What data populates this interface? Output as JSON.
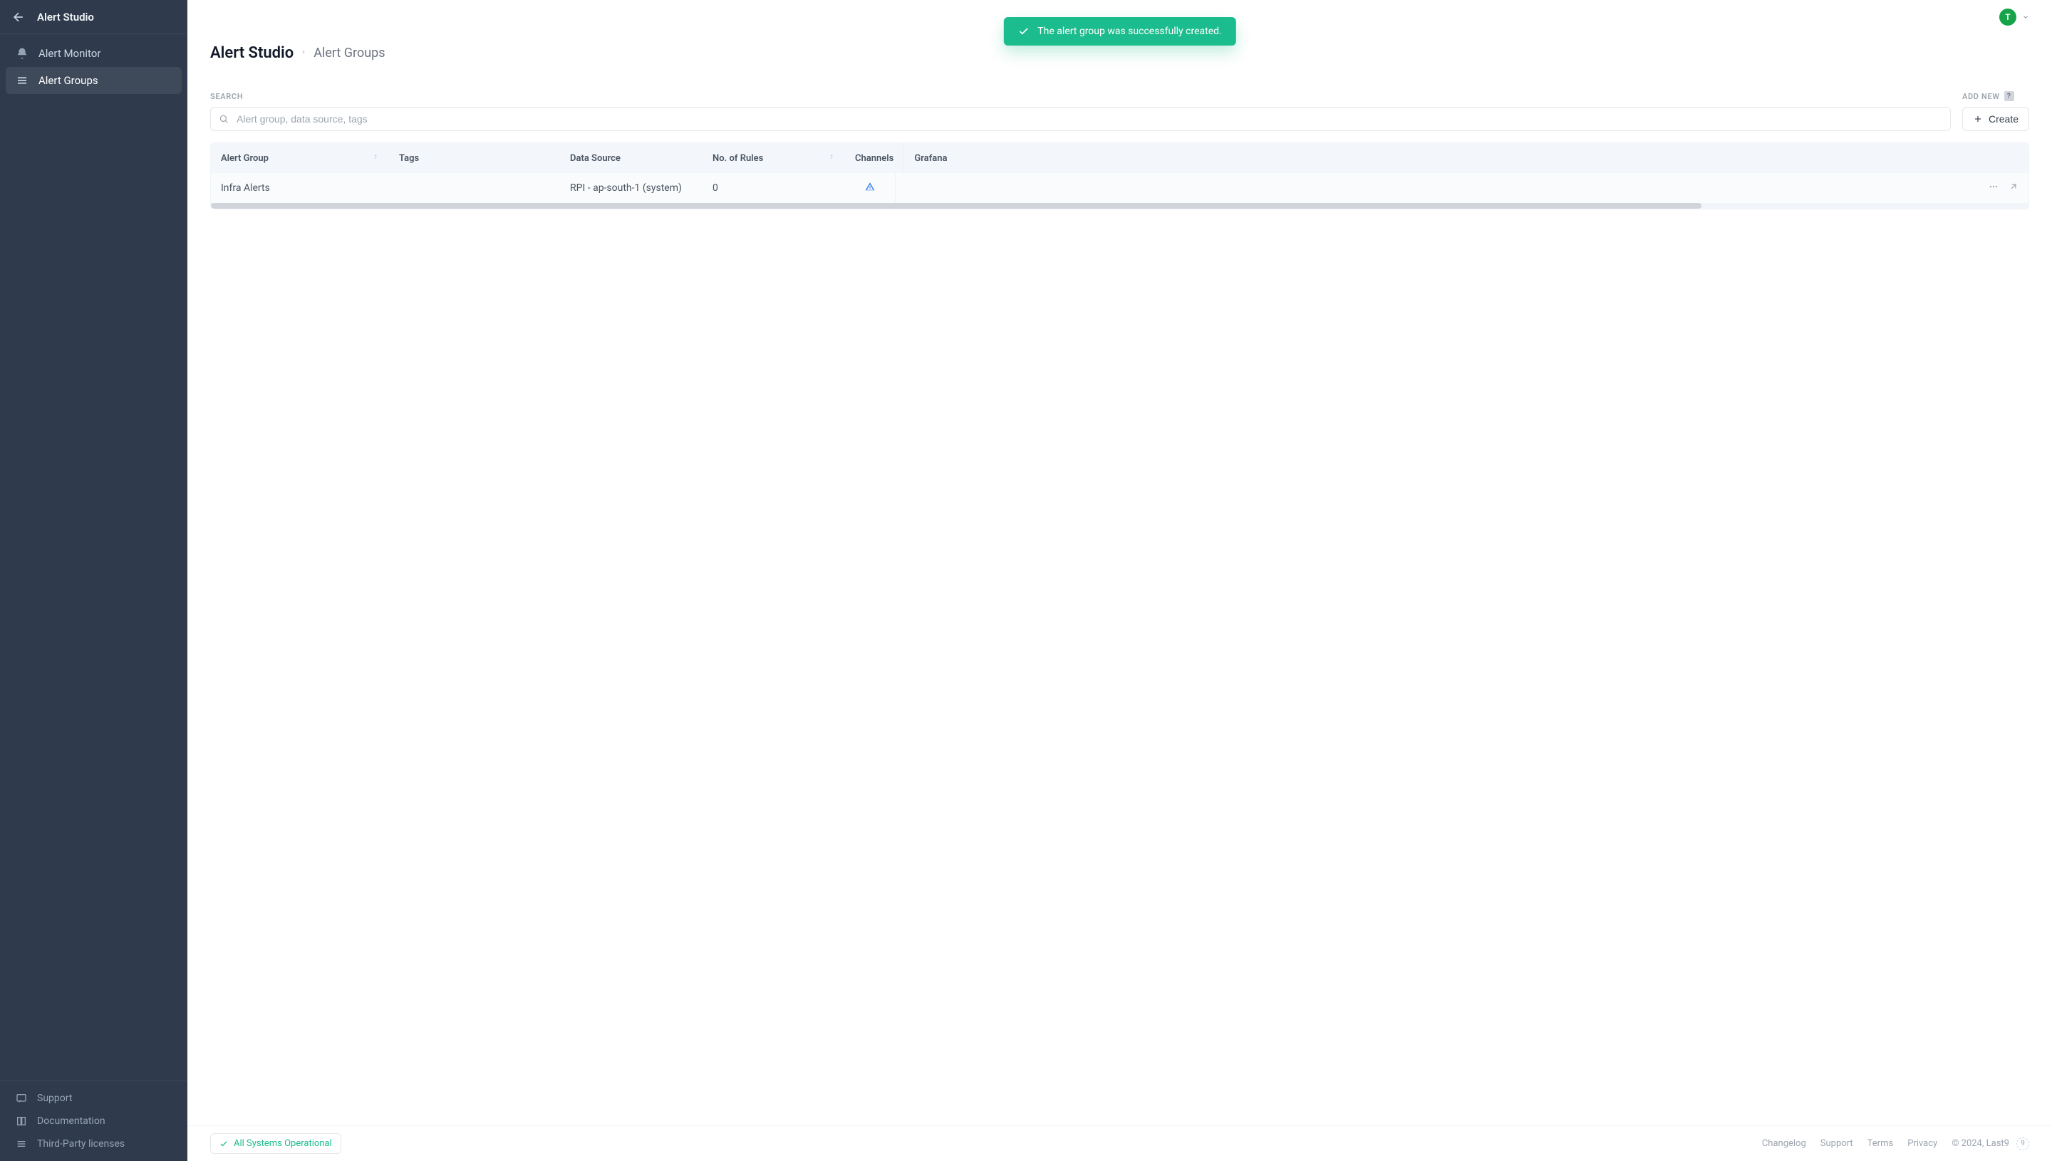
{
  "sidebar": {
    "title": "Alert Studio",
    "nav": [
      {
        "label": "Alert Monitor",
        "icon": "bell-icon"
      },
      {
        "label": "Alert Groups",
        "icon": "list-icon"
      }
    ],
    "footer": [
      {
        "label": "Support",
        "icon": "chat-icon"
      },
      {
        "label": "Documentation",
        "icon": "book-icon"
      },
      {
        "label": "Third-Party licenses",
        "icon": "list-icon"
      }
    ]
  },
  "topbar": {
    "avatar_initial": "T"
  },
  "toast": {
    "message": "The alert group was successfully created."
  },
  "breadcrumb": {
    "root": "Alert Studio",
    "current": "Alert Groups"
  },
  "toolbar": {
    "search_label": "SEARCH",
    "search_placeholder": "Alert group, data source, tags",
    "add_new_label": "ADD NEW",
    "create_label": "Create"
  },
  "table": {
    "columns": [
      "Alert Group",
      "Tags",
      "Data Source",
      "No. of Rules",
      "Channels",
      "Grafana"
    ],
    "rows": [
      {
        "group": "Infra Alerts",
        "tags": "",
        "data_source": "RPI - ap-south-1 (system)",
        "rules": "0",
        "channels_warn": true
      }
    ]
  },
  "bottombar": {
    "status": "All Systems Operational",
    "links": [
      "Changelog",
      "Support",
      "Terms",
      "Privacy"
    ],
    "copyright": "© 2024, Last9",
    "brand_badge": "9"
  }
}
